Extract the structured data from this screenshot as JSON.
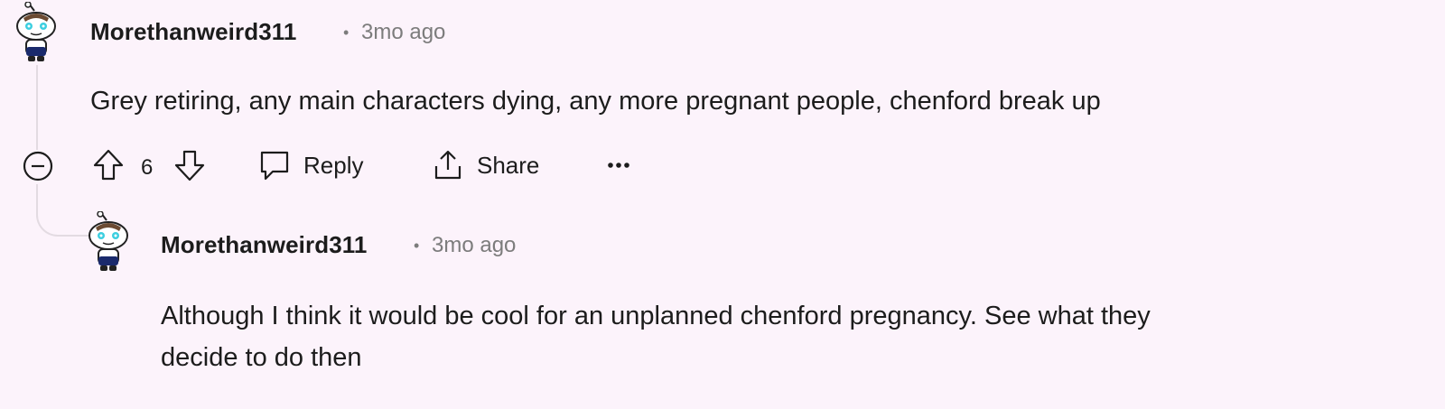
{
  "comments": [
    {
      "username": "Morethanweird311",
      "time": "3mo ago",
      "body": "Grey retiring, any main characters dying, any more pregnant people, chenford break up",
      "votes": "6",
      "actions": {
        "reply_label": "Reply",
        "share_label": "Share"
      }
    },
    {
      "username": "Morethanweird311",
      "time": "3mo ago",
      "body_lines": [
        "Although I think it would be cool for an unplanned chenford pregnancy. See what they",
        "decide to do then"
      ]
    }
  ],
  "icons": {
    "collapse": "collapse-minus-icon",
    "upvote": "upvote-arrow-icon",
    "downvote": "downvote-arrow-icon",
    "reply": "speech-bubble-icon",
    "share": "share-upload-icon",
    "more": "ellipsis-icon"
  }
}
